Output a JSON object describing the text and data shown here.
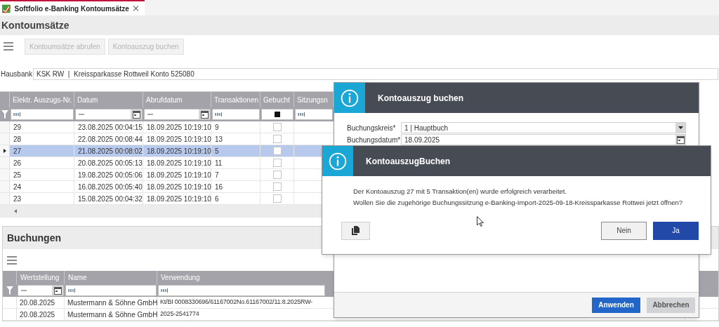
{
  "tab": {
    "title": "Softfolio e-Banking Kontoumsätze"
  },
  "page_title": "Kontoumsätze",
  "toolbar": {
    "buttons": [
      {
        "label": "Kontoumsätze abrufen",
        "disabled": true
      },
      {
        "label": "Kontoauszug buchen",
        "disabled": true
      }
    ]
  },
  "hausbank": {
    "label": "Hausbank",
    "value": "KSK RW  |  Kreissparkasse Rottweil Konto 525080"
  },
  "statements": {
    "columns": [
      {
        "label": "Elektr. Auszugs-Nr.",
        "kind": "text"
      },
      {
        "label": "Datum",
        "kind": "date"
      },
      {
        "label": "Abrufdatum",
        "kind": "date"
      },
      {
        "label": "Transaktionen",
        "kind": "text"
      },
      {
        "label": "Gebucht",
        "kind": "check"
      },
      {
        "label": "Sitzungsn",
        "kind": "text"
      }
    ],
    "rows": [
      {
        "nr": "29",
        "datum": "23.08.2025 00:04:15",
        "abrufdatum": "18.09.2025 10:19:10",
        "transaktionen": "9",
        "gebucht": false,
        "selected": false
      },
      {
        "nr": "28",
        "datum": "22.08.2025 00:08:44",
        "abrufdatum": "18.09.2025 10:19:10",
        "transaktionen": "13",
        "gebucht": false,
        "selected": false
      },
      {
        "nr": "27",
        "datum": "21.08.2025 00:08:02",
        "abrufdatum": "18.09.2025 10:19:10",
        "transaktionen": "5",
        "gebucht": false,
        "selected": true
      },
      {
        "nr": "26",
        "datum": "20.08.2025 00:05:13",
        "abrufdatum": "18.09.2025 10:19:10",
        "transaktionen": "11",
        "gebucht": false,
        "selected": false
      },
      {
        "nr": "25",
        "datum": "19.08.2025 00:05:06",
        "abrufdatum": "18.09.2025 10:19:10",
        "transaktionen": "7",
        "gebucht": false,
        "selected": false
      },
      {
        "nr": "24",
        "datum": "16.08.2025 00:05:40",
        "abrufdatum": "18.09.2025 10:19:10",
        "transaktionen": "16",
        "gebucht": false,
        "selected": false
      },
      {
        "nr": "23",
        "datum": "15.08.2025 00:04:32",
        "abrufdatum": "18.09.2025 10:19:10",
        "transaktionen": "6",
        "gebucht": false,
        "selected": false
      }
    ]
  },
  "bookings": {
    "title": "Buchungen",
    "columns": [
      {
        "label": "Wertstellung",
        "kind": "date"
      },
      {
        "label": "Name",
        "kind": "text"
      },
      {
        "label": "Verwendung",
        "kind": "text"
      }
    ],
    "rows": [
      {
        "wertstellung": "20.08.2025",
        "name": "Mustermann & Söhne GmbH",
        "verwendung": "Kt/BI 0008330696/61167002No.61167002/11.8.2025RW-"
      },
      {
        "wertstellung": "20.08.2025",
        "name": "Mustermann & Söhne GmbH",
        "verwendung": "2025-2541774"
      }
    ]
  },
  "dialog_main": {
    "title": "Kontoauszug buchen",
    "fields": [
      {
        "label": "Buchungskreis*",
        "value": "1  |  Hauptbuch",
        "kind": "select"
      },
      {
        "label": "Buchungsdatum*",
        "value": "18.09.2025",
        "kind": "date"
      }
    ],
    "buttons": [
      {
        "label": "Anwenden",
        "primary": true
      },
      {
        "label": "Abbrechen",
        "primary": false
      }
    ]
  },
  "dialog_confirm": {
    "title": "KontoauszugBuchen",
    "message": [
      "Der Kontoauszug 27 mit 5 Transaktion(en) wurde erfolgreich verarbeitet.",
      "Wollen Sie die zugehörige Buchungssitzung e-Banking-Import-2025-09-18-Kreissparkasse Rottwei jetzt öffnen?"
    ],
    "buttons": [
      {
        "label": "Nein",
        "primary": false
      },
      {
        "label": "Ja",
        "primary": true
      }
    ]
  }
}
